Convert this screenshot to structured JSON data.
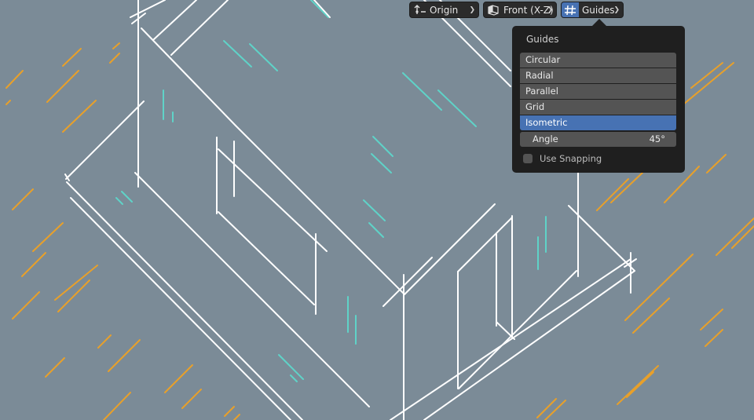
{
  "header": {
    "pivot_label": "Origin",
    "view_label": "Front (X-Z)",
    "guides_label": "Guides"
  },
  "popover": {
    "title": "Guides",
    "guide_types": [
      "Circular",
      "Radial",
      "Parallel",
      "Grid",
      "Isometric"
    ],
    "selected": "Isometric",
    "angle_label": "Angle",
    "angle_value": "45°",
    "use_snapping_label": "Use Snapping",
    "use_snapping": false
  },
  "colors": {
    "viewport_bg": "#7b8b97",
    "stroke_white": "#ffffff",
    "stroke_orange": "#e8a02a",
    "stroke_teal": "#5fd3c8",
    "accent": "#4772b3"
  },
  "icons": [
    "transform-pivot-icon",
    "view-cube-icon",
    "grid-guides-icon",
    "chevron-down-icon"
  ]
}
